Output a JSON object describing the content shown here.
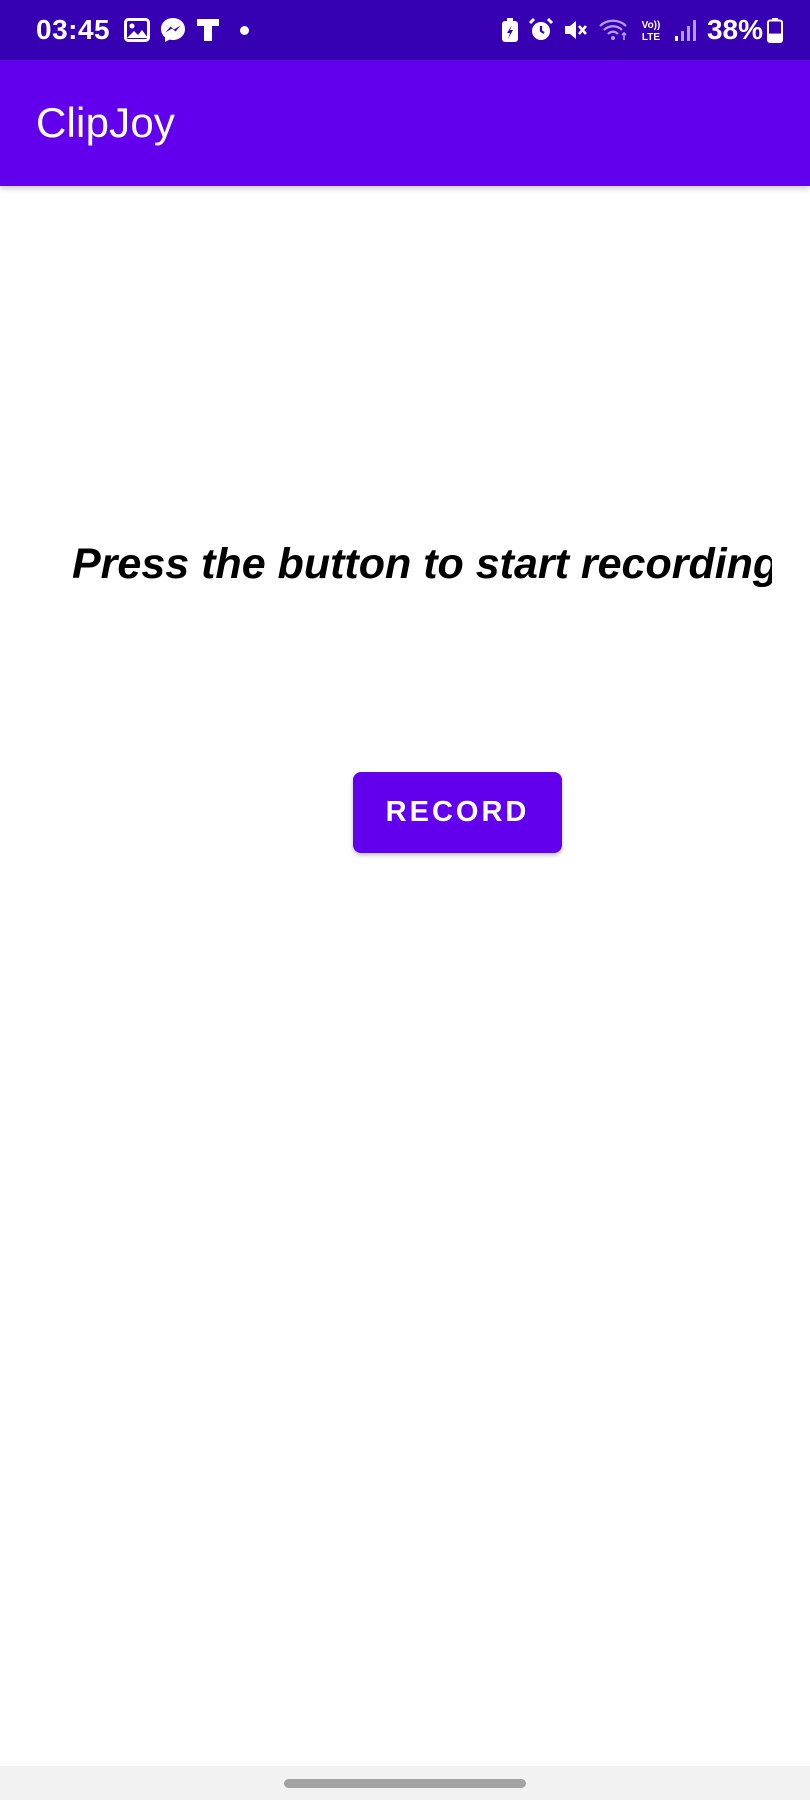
{
  "status_bar": {
    "time": "03:45",
    "battery_percent": "38%",
    "left_icons": [
      "gallery-icon",
      "messenger-icon",
      "t-app-icon",
      "notification-dot"
    ],
    "right_icons": [
      "battery-saver-icon",
      "alarm-icon",
      "mute-icon",
      "wifi-icon",
      "volte-icon",
      "signal-icon",
      "battery-icon"
    ],
    "volte_label_top": "Vo))",
    "volte_label_bottom": "LTE",
    "battery_level": 0.38
  },
  "app_bar": {
    "title": "ClipJoy"
  },
  "main": {
    "prompt": "Press the button to start recording",
    "record_button_label": "RECORD"
  },
  "colors": {
    "status_bar": "#3700b3",
    "primary": "#6200ee",
    "background": "#ffffff",
    "text": "#000000",
    "nav_bar": "#f2f2f2"
  }
}
